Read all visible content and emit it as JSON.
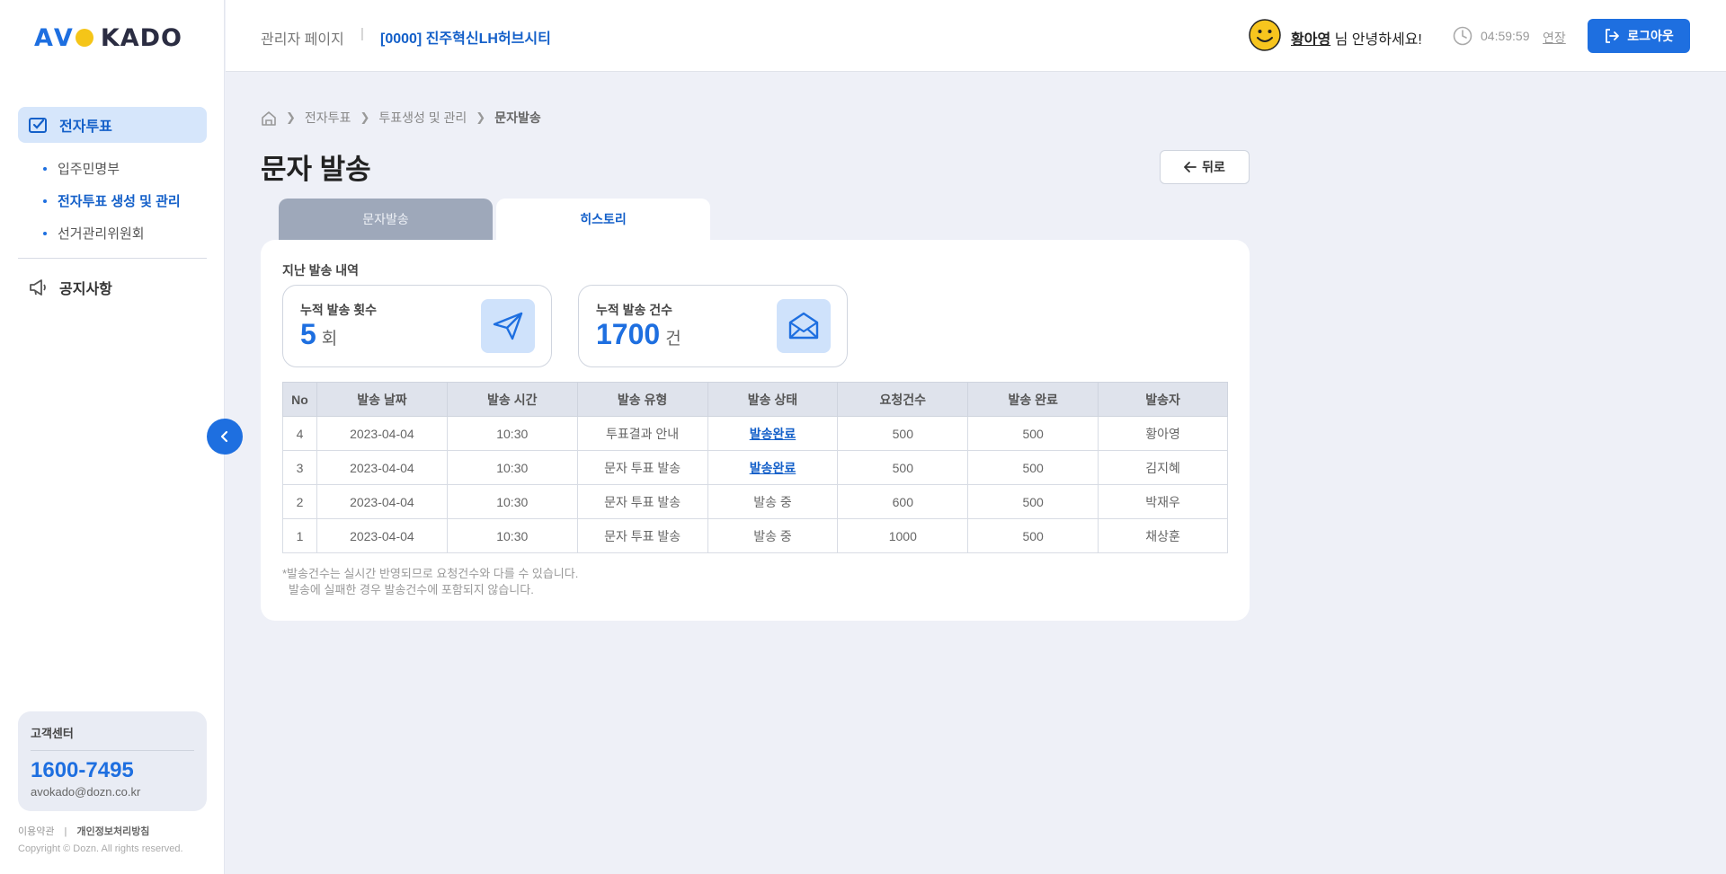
{
  "logo": {
    "text": "AVOKADO"
  },
  "sidebar": {
    "main_item": "전자투표",
    "sub_items": [
      {
        "label": "입주민명부"
      },
      {
        "label": "전자투표 생성 및 관리"
      },
      {
        "label": "선거관리위원회"
      }
    ],
    "notice": "공지사항",
    "customer_center": {
      "title": "고객센터",
      "phone": "1600-7495",
      "email": "avokado@dozn.co.kr"
    },
    "footer": {
      "terms": "이용약관",
      "separator": "|",
      "privacy": "개인정보처리방침",
      "copyright": "Copyright © Dozn. All rights reserved."
    }
  },
  "header": {
    "admin_label": "관리자 페이지",
    "separator": "|",
    "site": "[0000] 진주혁신LH허브시티",
    "user_name": "황아영",
    "greeting": " 님 안녕하세요!",
    "time": "04:59:59",
    "extend": "연장",
    "logout": "로그아웃"
  },
  "breadcrumb": [
    "전자투표",
    "투표생성 및 관리",
    "문자발송"
  ],
  "page": {
    "title": "문자 발송",
    "back": "뒤로"
  },
  "tabs": [
    {
      "label": "문자발송",
      "active": false
    },
    {
      "label": "히스토리",
      "active": true
    }
  ],
  "history": {
    "section_title": "지난 발송 내역",
    "stats": [
      {
        "label": "누적 발송 횟수",
        "value": "5",
        "unit": "회",
        "icon": "paper-plane-icon"
      },
      {
        "label": "누적 발송 건수",
        "value": "1700",
        "unit": "건",
        "icon": "envelope-icon"
      }
    ],
    "table": {
      "columns": [
        "No",
        "발송 날짜",
        "발송 시간",
        "발송 유형",
        "발송 상태",
        "요청건수",
        "발송 완료",
        "발송자"
      ],
      "rows": [
        [
          "4",
          "2023-04-04",
          "10:30",
          "투표결과 안내",
          "발송완료",
          "500",
          "500",
          "황아영"
        ],
        [
          "3",
          "2023-04-04",
          "10:30",
          "문자 투표 발송",
          "발송완료",
          "500",
          "500",
          "김지혜"
        ],
        [
          "2",
          "2023-04-04",
          "10:30",
          "문자 투표 발송",
          "발송 중",
          "600",
          "500",
          "박재우"
        ],
        [
          "1",
          "2023-04-04",
          "10:30",
          "문자 투표 발송",
          "발송 중",
          "1000",
          "500",
          "채상훈"
        ]
      ]
    },
    "notes": [
      "*발송건수는 실시간 반영되므로 요청건수와 다를 수 있습니다.",
      "발송에 실패한 경우 발송건수에 포함되지 않습니다."
    ]
  },
  "colors": {
    "primary": "#1e6fe0",
    "background": "#eef0f7"
  }
}
